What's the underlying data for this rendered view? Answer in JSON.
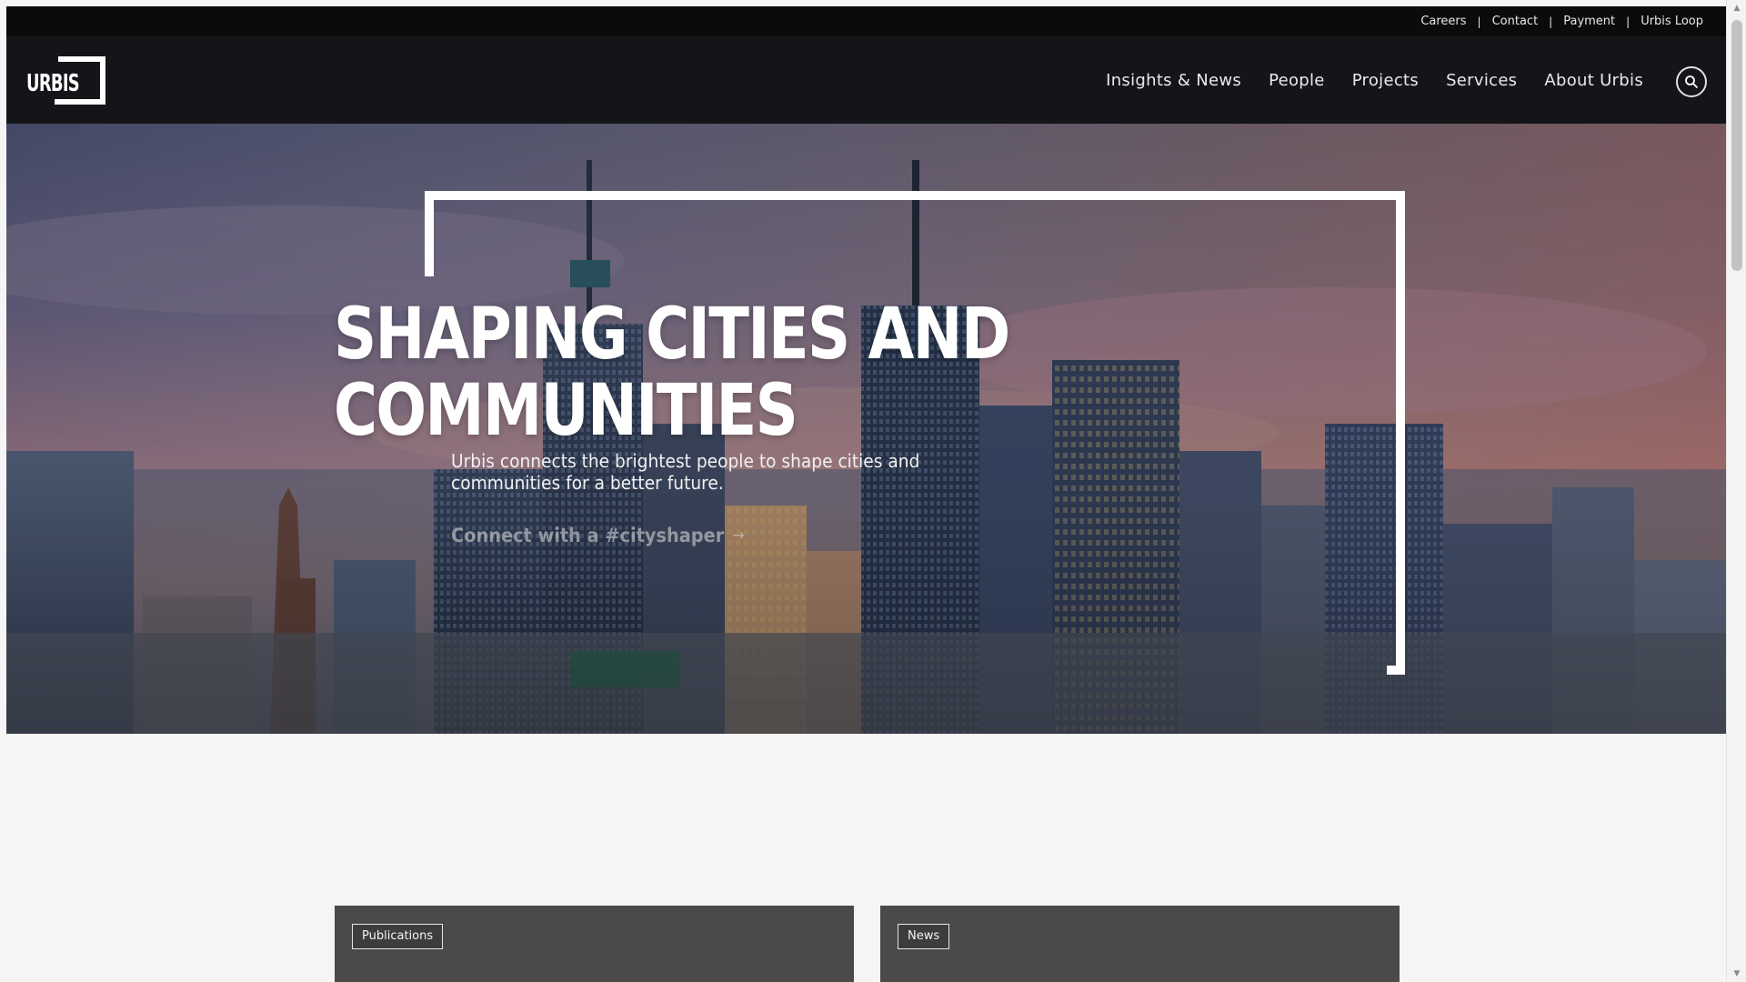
{
  "utility_nav": {
    "items": [
      {
        "label": "Careers"
      },
      {
        "label": "Contact"
      },
      {
        "label": "Payment"
      },
      {
        "label": "Urbis Loop"
      }
    ],
    "separator": "|"
  },
  "brand": {
    "logo_text": "URBIS"
  },
  "main_nav": {
    "items": [
      {
        "label": "Insights & News"
      },
      {
        "label": "People"
      },
      {
        "label": "Projects"
      },
      {
        "label": "Services"
      },
      {
        "label": "About Urbis"
      }
    ],
    "search_icon": "search-icon"
  },
  "hero": {
    "title_line1": "SHAPING CITIES AND",
    "title_line2": "COMMUNITIES",
    "subtitle": "Urbis connects the brightest people to shape cities and communities for a better future.",
    "cta_label": "Connect with a #cityshaper",
    "cta_icon": "arrow-right-icon"
  },
  "cards": [
    {
      "tag": "Publications"
    },
    {
      "tag": "News"
    }
  ],
  "colors": {
    "top_bar": "#0b0b0b",
    "nav_bar": "#141519",
    "page_bg": "#f5f5f5",
    "card_bg": "#4a4a4a",
    "text_light": "#ffffff"
  }
}
